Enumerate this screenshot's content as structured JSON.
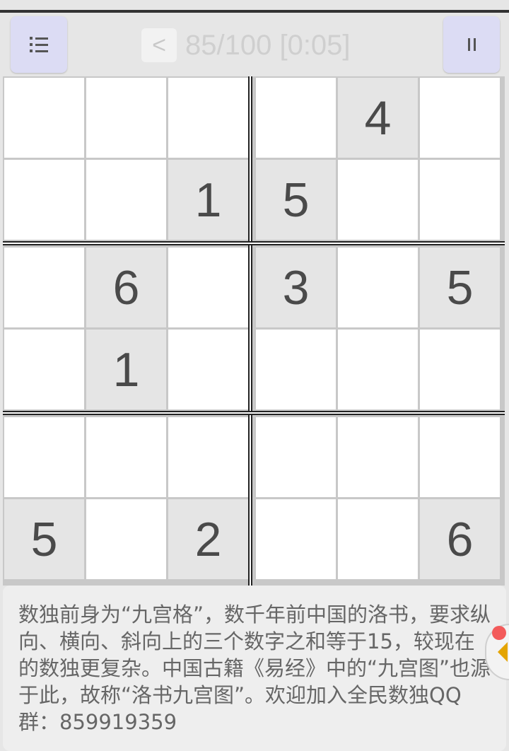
{
  "header": {
    "back_label": "<",
    "progress": "85/100 [0:05]",
    "menu_icon": "list-icon",
    "pause_icon": "pause-icon"
  },
  "board": {
    "rows": 6,
    "cols": 6,
    "cells": [
      [
        "",
        "",
        "",
        "",
        "4",
        ""
      ],
      [
        "",
        "",
        "1",
        "5",
        "",
        ""
      ],
      [
        "",
        "6",
        "",
        "3",
        "",
        "5"
      ],
      [
        "",
        "1",
        "",
        "",
        "",
        ""
      ],
      [
        "",
        "",
        "",
        "",
        "",
        ""
      ],
      [
        "5",
        "",
        "2",
        "",
        "",
        "6"
      ]
    ],
    "given": [
      [
        false,
        false,
        false,
        false,
        true,
        false
      ],
      [
        false,
        false,
        true,
        true,
        false,
        false
      ],
      [
        false,
        true,
        false,
        true,
        false,
        true
      ],
      [
        false,
        true,
        false,
        false,
        false,
        false
      ],
      [
        false,
        false,
        false,
        false,
        false,
        false
      ],
      [
        true,
        false,
        true,
        false,
        false,
        true
      ]
    ],
    "colors": {
      "given_bg": "#e5e5e5",
      "empty_bg": "#ffffff",
      "digit": "#4a4a4a"
    }
  },
  "info": {
    "text": "数独前身为“九宫格”，数千年前中国的洛书，要求纵向、横向、斜向上的三个数字之和等于15，较现在的数独更复杂。中国古籍《易经》中的“九宫图”也源于此，故称“洛书九宫图”。欢迎加入全民数独QQ群：859919359"
  },
  "side_tab": {
    "icon": "chevron-left-icon",
    "badge_color": "#f35a5a"
  }
}
